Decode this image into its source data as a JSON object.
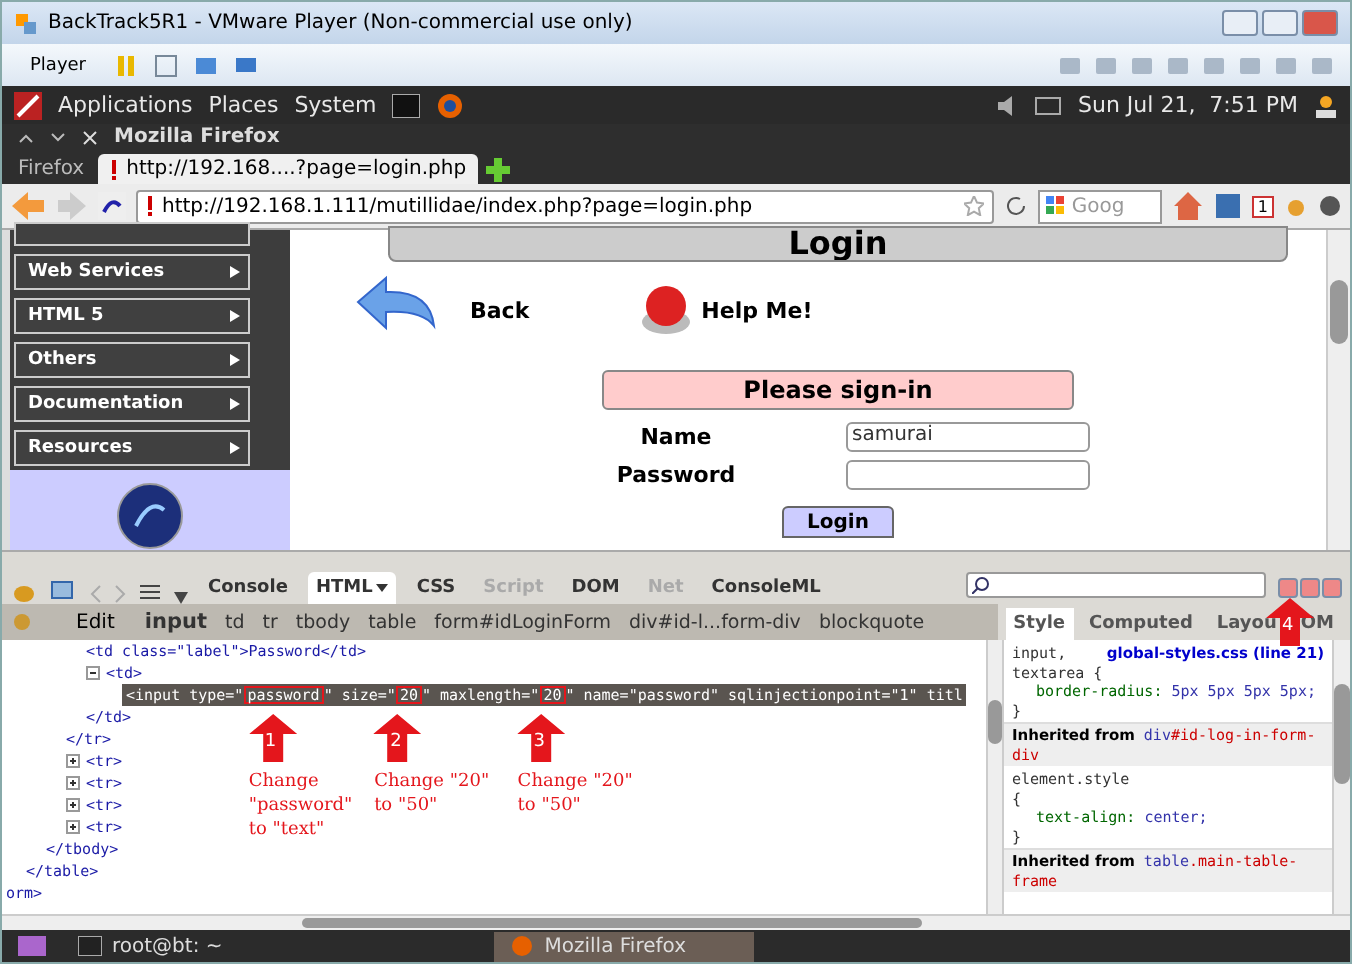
{
  "vm_window": {
    "title": "BackTrack5R1 - VMware Player (Non-commercial use only)",
    "menu": "Player"
  },
  "gnome_panel": {
    "menus": [
      "Applications",
      "Places",
      "System"
    ],
    "clock": "Sun Jul 21,  7:51 PM"
  },
  "firefox": {
    "title": "Mozilla Firefox",
    "menu_button": "Firefox",
    "tabs": [
      {
        "label": "http://192.168....?page=login.php",
        "selected": true
      }
    ],
    "url": "http://192.168.1.111/mutillidae/index.php?page=login.php",
    "search_placeholder": "Goog",
    "badge": "1"
  },
  "page": {
    "sidebar": [
      "Web Services",
      "HTML 5",
      "Others",
      "Documentation",
      "Resources"
    ],
    "heading": "Login",
    "back": "Back",
    "help": "Help Me!",
    "form_title": "Please sign-in",
    "fields": [
      {
        "label": "Name",
        "value": "samurai"
      },
      {
        "label": "Password"
      }
    ],
    "button": "Login"
  },
  "firebug": {
    "panels": [
      {
        "label": "Console",
        "selected": false,
        "disabled": false
      },
      {
        "label": "HTML",
        "selected": true,
        "disabled": false
      },
      {
        "label": "CSS",
        "selected": false,
        "disabled": false
      },
      {
        "label": "Script",
        "selected": false,
        "disabled": true
      },
      {
        "label": "DOM",
        "selected": false,
        "disabled": false
      },
      {
        "label": "Net",
        "selected": false,
        "disabled": true
      },
      {
        "label": "ConsoleML",
        "selected": false,
        "disabled": false
      }
    ],
    "edit": "Edit",
    "breadcrumbs": [
      {
        "label": "input",
        "selected": true
      },
      {
        "label": "td",
        "selected": false
      },
      {
        "label": "tr",
        "selected": false
      },
      {
        "label": "tbody",
        "selected": false
      },
      {
        "label": "table",
        "selected": false
      },
      {
        "label": "form#idLoginForm",
        "selected": false
      },
      {
        "label": "div#id-l...form-div",
        "selected": false
      },
      {
        "label": "blockquote",
        "selected": false
      }
    ],
    "side_tabs": [
      {
        "label": "Style",
        "selected": true
      },
      {
        "label": "Computed",
        "selected": false
      },
      {
        "label": "Layou",
        "selected": false
      },
      {
        "label": "OM",
        "selected": false
      }
    ],
    "html_tree": [
      {
        "close": "orm>",
        "children": [
          {
            "close": "</table>",
            "children": [
              {
                "close": "</tbody>",
                "children": [
                  {
                    "close": "</tr>",
                    "children": [
                      {
                        "text": "<td class=\"label\">Password</td>"
                      },
                      {
                        "text": "<td>",
                        "expanded": true,
                        "close": "</td>",
                        "children": [
                          {
                            "kind": "selected",
                            "segments": [
                              {
                                "text": "<input type=\""
                              },
                              {
                                "text": "password",
                                "mark": {
                                  "number": "1",
                                  "note": "Change \"password\" to \"text\""
                                }
                              },
                              {
                                "text": "\" size=\""
                              },
                              {
                                "text": "20",
                                "mark": {
                                  "number": "2",
                                  "note": "Change \"20\" to \"50\""
                                }
                              },
                              {
                                "text": "\" maxlength=\""
                              },
                              {
                                "text": "20",
                                "mark": {
                                  "number": "3",
                                  "note": "Change \"20\" to \"50\""
                                }
                              },
                              {
                                "text": "\" name=\"password\" sqlinjectionpoint=\"1\" titl"
                              }
                            ]
                          }
                        ]
                      }
                    ]
                  },
                  {
                    "text": "<tr>",
                    "expanded": false
                  },
                  {
                    "text": "<tr>",
                    "expanded": false
                  },
                  {
                    "text": "<tr>",
                    "expanded": false
                  },
                  {
                    "text": "<tr>",
                    "expanded": false
                  }
                ]
              }
            ]
          }
        ]
      }
    ],
    "styles": [
      {
        "kind": "rule",
        "selector": [
          "input,",
          "textarea {"
        ],
        "source": "global-styles.css (line 21)",
        "props": [
          {
            "name": "border-radius:",
            "value": "5px 5px 5px 5px;"
          }
        ],
        "close": "}"
      },
      {
        "kind": "inherited",
        "prefix": "Inherited from",
        "tag": "div",
        "cls": "#id-log-in-form-div"
      },
      {
        "kind": "rule",
        "selector": [
          "element.style",
          "{"
        ],
        "props": [
          {
            "name": "text-align:",
            "value": "center;"
          }
        ],
        "close": "}"
      },
      {
        "kind": "inherited",
        "prefix": "Inherited from",
        "tag": "table",
        "cls": ".main-table-frame"
      }
    ],
    "arrow_note": "4"
  },
  "taskbar": [
    {
      "label": "root@bt: ~",
      "kind": "terminal",
      "selected": false
    },
    {
      "label": "Mozilla Firefox",
      "kind": "firefox",
      "selected": true
    }
  ]
}
